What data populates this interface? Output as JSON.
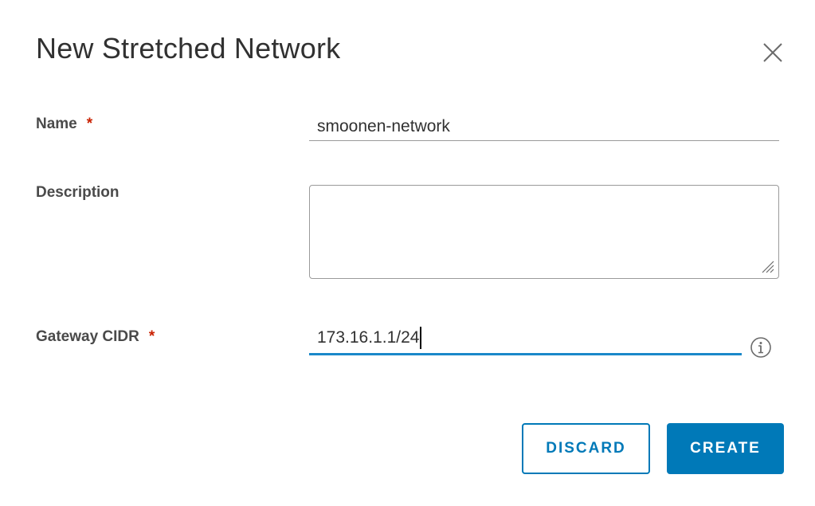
{
  "dialog": {
    "title": "New Stretched Network",
    "close_icon": "close-icon"
  },
  "form": {
    "name": {
      "label": "Name",
      "required_marker": "*",
      "value": "smoonen-network"
    },
    "description": {
      "label": "Description",
      "value": ""
    },
    "gateway": {
      "label": "Gateway CIDR",
      "required_marker": "*",
      "value": "173.16.1.1/24",
      "info_icon": "info-icon"
    }
  },
  "actions": {
    "discard_label": "DISCARD",
    "create_label": "CREATE"
  },
  "colors": {
    "accent": "#0079b8",
    "focus_underline": "#1a88c9",
    "required": "#c92100",
    "text": "#313131"
  }
}
